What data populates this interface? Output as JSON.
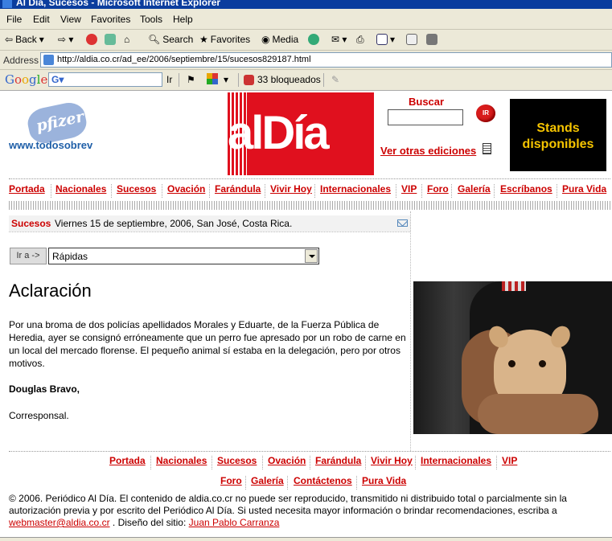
{
  "window": {
    "title": "Al Día, Sucesos - Microsoft Internet Explorer"
  },
  "menu": [
    "File",
    "Edit",
    "View",
    "Favorites",
    "Tools",
    "Help"
  ],
  "toolbar": {
    "back": "Back",
    "search": "Search",
    "favorites": "Favorites",
    "media": "Media"
  },
  "address": {
    "label": "Address",
    "url": "http://aldia.co.cr/ad_ee/2006/septiembre/15/sucesos829187.html"
  },
  "google_bar": {
    "logo": "Google",
    "search_label": "Ir",
    "blocked": "33 bloqueados"
  },
  "header": {
    "ad_left_text": "www.todosobrev",
    "ad_left_brand": "pfizer",
    "logo_text": "alDía",
    "search_label": "Buscar",
    "search_button": "IR",
    "other_editions": "Ver otras ediciones",
    "ad_right_line1": "Stands",
    "ad_right_line2": "disponibles"
  },
  "nav_top": [
    "Portada",
    "Nacionales",
    "Sucesos",
    "Ovación",
    "Farándula",
    "Vivir Hoy",
    "Internacionales",
    "VIP",
    "Foro",
    "Galería",
    "Escríbanos",
    "Pura Vida"
  ],
  "section": {
    "name": "Sucesos",
    "dateline": "Viernes 15 de septiembre, 2006, San José, Costa Rica."
  },
  "jump": {
    "button": "Ir a ->",
    "selected": "Rápidas"
  },
  "article": {
    "headline": "Aclaración",
    "body": "Por una broma de dos policías apellidados Morales y Eduarte, de la Fuerza Pública de Heredia, ayer se consignó erróneamente que un perro fue apresado por un robo de carne en un local del mercado florense. El pequeño animal sí estaba en la delegación, pero por otros motivos.",
    "author": "Douglas Bravo,",
    "role": "Corresponsal."
  },
  "nav_bottom_row1": [
    "Portada",
    "Nacionales",
    "Sucesos",
    "Ovación",
    "Farándula",
    "Vivir Hoy",
    "Internacionales",
    "VIP"
  ],
  "nav_bottom_row2": [
    "Foro",
    "Galería",
    "Contáctenos",
    "Pura Vida"
  ],
  "footer": {
    "text": "© 2006. Periódico Al Día. El contenido de aldia.co.cr no puede ser reproducido, transmitido ni distribuido total o parcialmente sin la autorización previa y por escrito del Periódico Al Día. Si usted necesita mayor información o brindar recomendaciones, escriba a",
    "email": "webmaster@aldia.co.cr",
    "design_prefix": ". Diseño del sitio:",
    "designer": "Juan Pablo Carranza"
  },
  "colors": {
    "brand_red": "#e0101e",
    "link_red": "#cc0000",
    "ad_yellow": "#f5c400"
  }
}
